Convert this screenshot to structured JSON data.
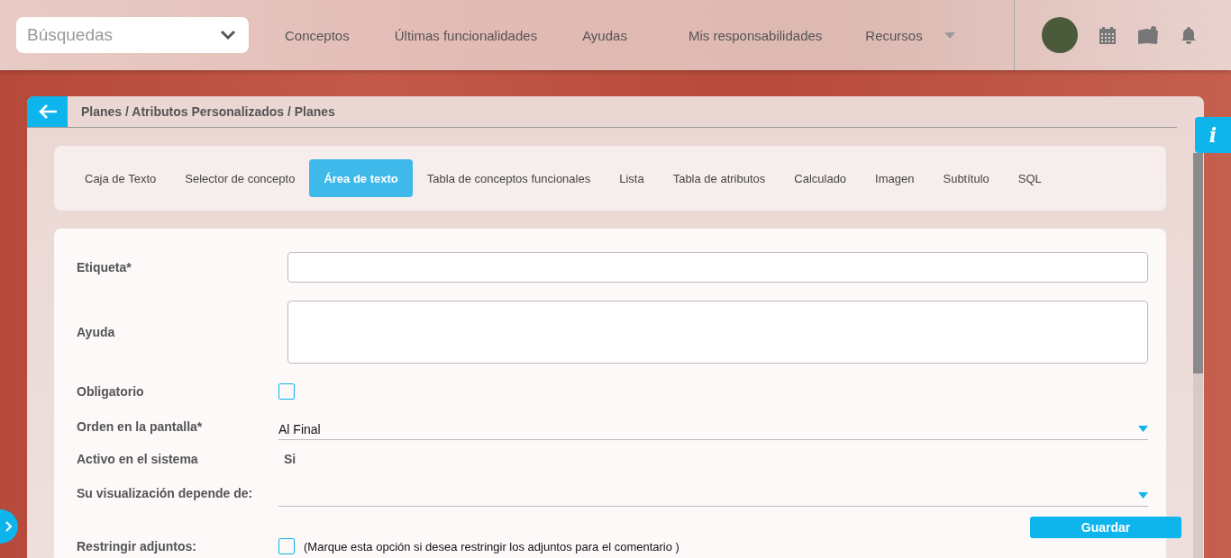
{
  "header": {
    "search": {
      "placeholder": "Búsquedas"
    },
    "nav": [
      {
        "label": "Conceptos"
      },
      {
        "label": "Últimas funcionalidades"
      },
      {
        "label": "Ayudas"
      },
      {
        "label": "Mis responsabilidades"
      },
      {
        "label": "Recursos"
      }
    ]
  },
  "info_button": "i",
  "breadcrumb": "Planes / Atributos Personalizados / Planes",
  "tabs": [
    {
      "label": "Caja de Texto",
      "selected": false
    },
    {
      "label": "Selector de concepto",
      "selected": false
    },
    {
      "label": "Área de texto",
      "selected": true
    },
    {
      "label": "Tabla de conceptos funcionales",
      "selected": false
    },
    {
      "label": "Lista",
      "selected": false
    },
    {
      "label": "Tabla de atributos",
      "selected": false
    },
    {
      "label": "Calculado",
      "selected": false
    },
    {
      "label": "Imagen",
      "selected": false
    },
    {
      "label": "Subtítulo",
      "selected": false
    },
    {
      "label": "SQL",
      "selected": false
    }
  ],
  "form": [
    {
      "kind": "input",
      "label": "Etiqueta*"
    },
    {
      "kind": "textarea",
      "label": "Ayuda"
    },
    {
      "kind": "checkbox",
      "label": "Obligatorio",
      "checked": false
    },
    {
      "kind": "select",
      "label": "Orden en la pantalla*",
      "value": "Al Final"
    },
    {
      "kind": "text",
      "label": "Activo en el sistema",
      "value": "Si"
    },
    {
      "kind": "select",
      "label": "Su visualización depende de:"
    },
    {
      "kind": "button",
      "label": "Guardar"
    },
    {
      "kind": "checkbox",
      "label": "Restringir adjuntos:",
      "checked": false,
      "note": "(Marque esta opción si desea restringir los adjuntos para el comentario )"
    }
  ]
}
